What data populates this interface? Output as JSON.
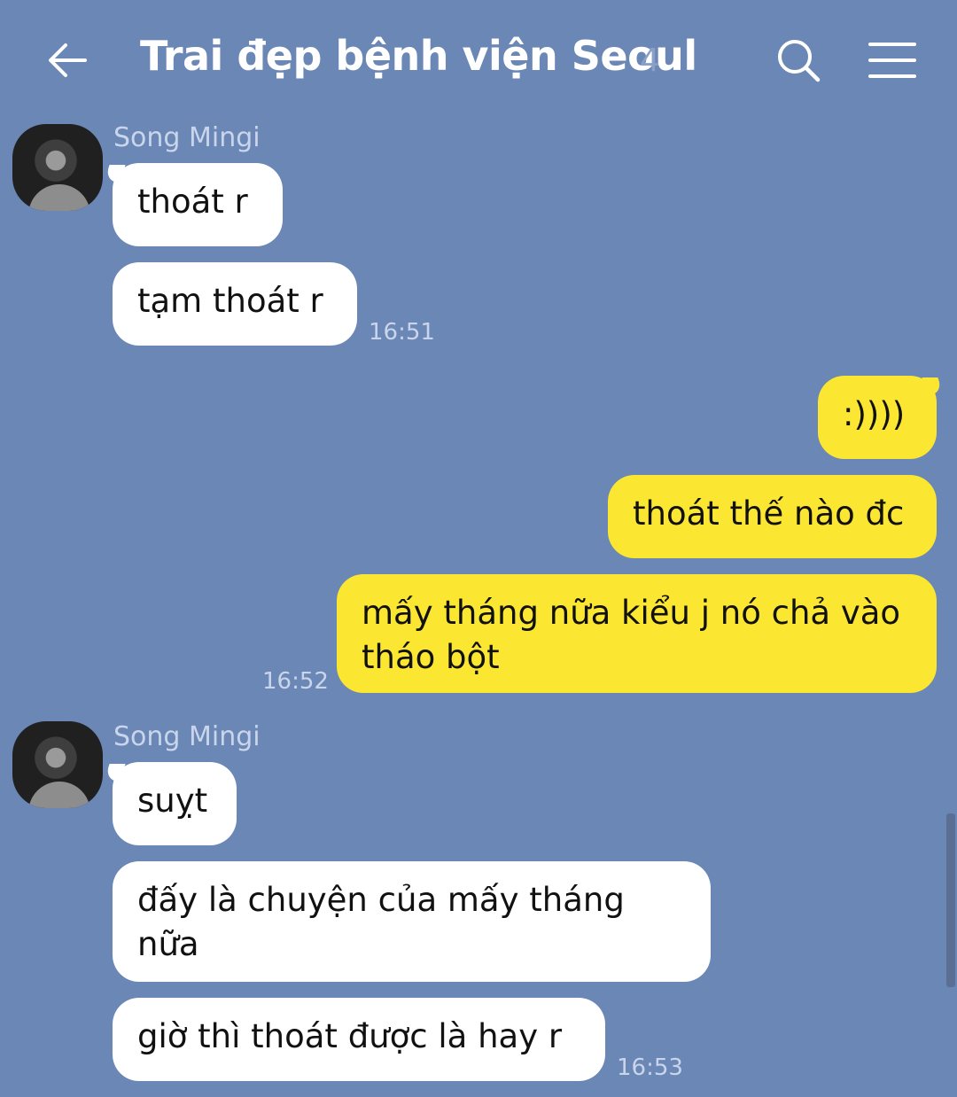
{
  "header": {
    "title": "Trai đẹp bệnh viện Seoul",
    "member_count": "4"
  },
  "chat": {
    "group1": {
      "sender": "Song Mingi",
      "messages": [
        "thoát r",
        "tạm thoát r"
      ],
      "time": "16:51"
    },
    "group2": {
      "messages": [
        ":))))",
        "thoát thế nào đc",
        "mấy tháng nữa kiểu j nó chả vào tháo bột"
      ],
      "time": "16:52"
    },
    "group3": {
      "sender": "Song Mingi",
      "messages": [
        "suỵt",
        "đấy là chuyện của mấy tháng nữa",
        "giờ thì thoát được là hay r"
      ],
      "time": "16:53"
    }
  },
  "colors": {
    "background": "#6b87b6",
    "outgoing_bubble": "#fbe631",
    "incoming_bubble": "#ffffff"
  },
  "icons": {
    "back": "back-arrow-icon",
    "search": "search-icon",
    "menu": "hamburger-menu-icon"
  }
}
